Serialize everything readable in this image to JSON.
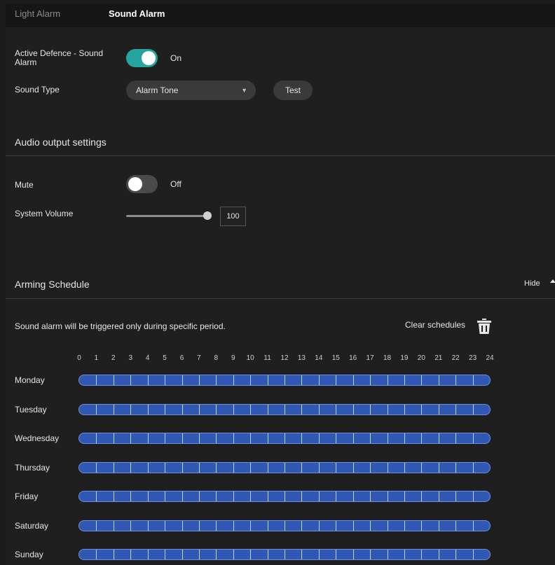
{
  "tabs": [
    {
      "label": "Light Alarm",
      "active": false
    },
    {
      "label": "Sound Alarm",
      "active": true
    }
  ],
  "active_defence": {
    "label": "Active Defence - Sound Alarm",
    "state_text": "On",
    "enabled": true
  },
  "sound_type": {
    "label": "Sound Type",
    "value": "Alarm Tone",
    "test_label": "Test"
  },
  "audio_output": {
    "title": "Audio output settings",
    "mute": {
      "label": "Mute",
      "state_text": "Off",
      "enabled": false
    },
    "volume": {
      "label": "System Volume",
      "value": "100"
    }
  },
  "schedule": {
    "title": "Arming Schedule",
    "hide_label": "Hide",
    "description": "Sound alarm will be triggered only during specific period.",
    "clear_label": "Clear schedules",
    "hours": [
      "0",
      "1",
      "2",
      "3",
      "4",
      "5",
      "6",
      "7",
      "8",
      "9",
      "10",
      "11",
      "12",
      "13",
      "14",
      "15",
      "16",
      "17",
      "18",
      "19",
      "20",
      "21",
      "22",
      "23",
      "24"
    ],
    "days": [
      "Monday",
      "Tuesday",
      "Wednesday",
      "Thursday",
      "Friday",
      "Saturday",
      "Sunday"
    ],
    "armed_all_day": true
  },
  "colors": {
    "accent": "#26a5a0",
    "schedule_fill": "#2f58b5",
    "background": "#1f1f1f"
  }
}
